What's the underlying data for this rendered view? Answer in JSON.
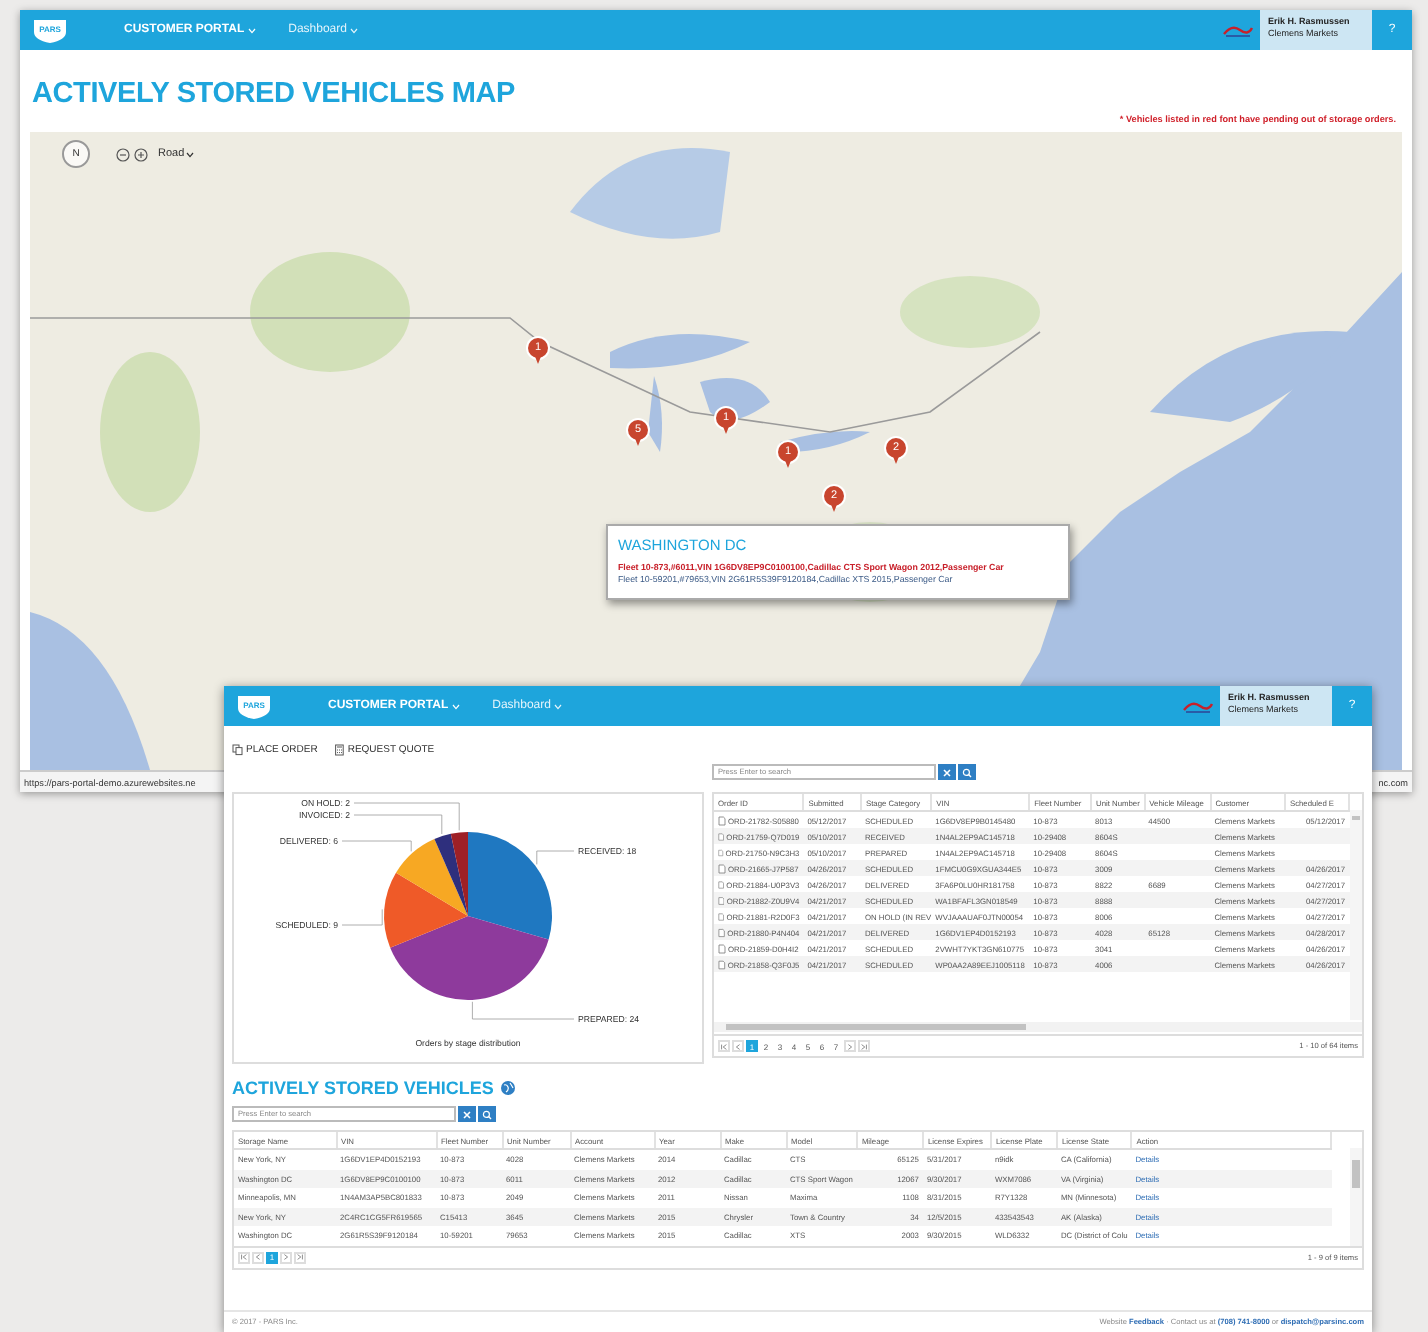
{
  "map_window": {
    "header": {
      "logo": "PARS",
      "portal": "CUSTOMER PORTAL",
      "menu": "Dashboard",
      "user_name": "Erik H. Rasmussen",
      "user_company": "Clemens Markets",
      "help": "?"
    },
    "title": "ACTIVELY STORED VEHICLES MAP",
    "note": "* Vehicles listed in red font have pending out of storage orders.",
    "map": {
      "compass": "N",
      "style": "Road",
      "markers": [
        {
          "count": "1"
        },
        {
          "count": "5"
        },
        {
          "count": "1"
        },
        {
          "count": "1"
        },
        {
          "count": "2"
        },
        {
          "count": "2"
        }
      ],
      "popup": {
        "title": "WASHINGTON DC",
        "lines": [
          {
            "text": "Fleet 10-873,#6011,VIN 1G6DV8EP9C0100100,Cadillac CTS Sport Wagon 2012,Passenger Car",
            "pending": true
          },
          {
            "text": "Fleet 10-59201,#79653,VIN 2G61R5S39F9120184,Cadillac XTS 2015,Passenger Car",
            "pending": false
          }
        ]
      }
    },
    "status_url": "https://pars-portal-demo.azurewebsites.ne",
    "status_end": "nc.com"
  },
  "dashboard_window": {
    "header": {
      "logo": "PARS",
      "portal": "CUSTOMER PORTAL",
      "menu": "Dashboard",
      "user_name": "Erik H. Rasmussen",
      "user_company": "Clemens Markets",
      "help": "?"
    },
    "toolbar": [
      "PLACE ORDER",
      "REQUEST QUOTE"
    ],
    "chart_data": {
      "type": "pie",
      "title": "Orders by stage distribution",
      "values": [
        18,
        24,
        9,
        6,
        2,
        2
      ],
      "value_labels": [
        "RECEIVED: 18",
        "PREPARED: 24",
        "SCHEDULED: 9",
        "DELIVERED: 6",
        "INVOICED: 2",
        "ON HOLD: 2"
      ]
    },
    "orders": {
      "placeholder": "Press Enter to search",
      "columns": [
        "Order ID",
        "Submitted",
        "Stage Category",
        "VIN",
        "Fleet Number",
        "Unit Number",
        "Vehicle Mileage",
        "Customer",
        "Scheduled E"
      ],
      "rows": [
        [
          "ORD-21782-S05880",
          "05/12/2017",
          "SCHEDULED",
          "1G6DV8EP9B0145480",
          "10-873",
          "8013",
          "44500",
          "Clemens Markets",
          "05/12/2017"
        ],
        [
          "ORD-21759-Q7D019",
          "05/10/2017",
          "RECEIVED",
          "1N4AL2EP9AC145718",
          "10-29408",
          "8604S",
          "",
          "Clemens Markets",
          ""
        ],
        [
          "ORD-21750-N9C3H3",
          "05/10/2017",
          "PREPARED",
          "1N4AL2EP9AC145718",
          "10-29408",
          "8604S",
          "",
          "Clemens Markets",
          ""
        ],
        [
          "ORD-21665-J7P587",
          "04/26/2017",
          "SCHEDULED",
          "1FMCU0G9XGUA344E5",
          "10-873",
          "3009",
          "",
          "Clemens Markets",
          "04/26/2017"
        ],
        [
          "ORD-21884-U0P3V3",
          "04/26/2017",
          "DELIVERED",
          "3FA6P0LU0HR181758",
          "10-873",
          "8822",
          "6689",
          "Clemens Markets",
          "04/27/2017"
        ],
        [
          "ORD-21882-Z0U9V4",
          "04/21/2017",
          "SCHEDULED",
          "WA1BFAFL3GN018549",
          "10-873",
          "8888",
          "",
          "Clemens Markets",
          "04/27/2017"
        ],
        [
          "ORD-21881-R2D0F3",
          "04/21/2017",
          "ON HOLD (IN REV",
          "WVJAAAUAF0JTN00054",
          "10-873",
          "8006",
          "",
          "Clemens Markets",
          "04/27/2017"
        ],
        [
          "ORD-21880-P4N404",
          "04/21/2017",
          "DELIVERED",
          "1G6DV1EP4D0152193",
          "10-873",
          "4028",
          "65128",
          "Clemens Markets",
          "04/28/2017"
        ],
        [
          "ORD-21859-D0H4I2",
          "04/21/2017",
          "SCHEDULED",
          "2VWHT7YKT3GN610775",
          "10-873",
          "3041",
          "",
          "Clemens Markets",
          "04/26/2017"
        ],
        [
          "ORD-21858-Q3F0J5",
          "04/21/2017",
          "SCHEDULED",
          "WP0AA2A89EEJ1005118",
          "10-873",
          "4006",
          "",
          "Clemens Markets",
          "04/26/2017"
        ]
      ],
      "pages": [
        {
          "label": "1",
          "selected": true
        },
        {
          "label": "2",
          "selected": false
        },
        {
          "label": "3",
          "selected": false
        },
        {
          "label": "4",
          "selected": false
        },
        {
          "label": "5",
          "selected": false
        },
        {
          "label": "6",
          "selected": false
        },
        {
          "label": "7",
          "selected": false
        }
      ],
      "summary": "1 - 10 of 64 items"
    },
    "stored": {
      "title": "ACTIVELY STORED VEHICLES",
      "placeholder": "Press Enter to search",
      "columns": [
        "Storage Name",
        "VIN",
        "Fleet Number",
        "Unit Number",
        "Account",
        "Year",
        "Make",
        "Model",
        "Mileage",
        "License Expires",
        "License Plate",
        "License State",
        "Action"
      ],
      "rows": [
        [
          "New York, NY",
          "1G6DV1EP4D0152193",
          "10-873",
          "4028",
          "Clemens Markets",
          "2014",
          "Cadillac",
          "CTS",
          "65125",
          "5/31/2017",
          "n9idk",
          "CA (California)",
          "Details"
        ],
        [
          "Washington DC",
          "1G6DV8EP9C0100100",
          "10-873",
          "6011",
          "Clemens Markets",
          "2012",
          "Cadillac",
          "CTS Sport Wagon",
          "12067",
          "9/30/2017",
          "WXM7086",
          "VA (Virginia)",
          "Details"
        ],
        [
          "Minneapolis, MN",
          "1N4AM3AP5BC801833",
          "10-873",
          "2049",
          "Clemens Markets",
          "2011",
          "Nissan",
          "Maxima",
          "1108",
          "8/31/2015",
          "R7Y1328",
          "MN (Minnesota)",
          "Details"
        ],
        [
          "New York, NY",
          "2C4RC1CG5FR619565",
          "C15413",
          "3645",
          "Clemens Markets",
          "2015",
          "Chrysler",
          "Town & Country",
          "34",
          "12/5/2015",
          "433543543",
          "AK (Alaska)",
          "Details"
        ],
        [
          "Washington DC",
          "2G61R5S39F9120184",
          "10-59201",
          "79653",
          "Clemens Markets",
          "2015",
          "Cadillac",
          "XTS",
          "2003",
          "9/30/2015",
          "WLD6332",
          "DC (District of Colu",
          "Details"
        ]
      ],
      "pages": [
        {
          "label": "1",
          "selected": true
        }
      ],
      "summary": "1 - 9 of 9 items"
    },
    "footer": {
      "copyright": "© 2017 - PARS Inc.",
      "contact": "Website **Feedback** · Contact us at **(708) 741-8000** or **dispatch@parsinc.com**"
    }
  }
}
